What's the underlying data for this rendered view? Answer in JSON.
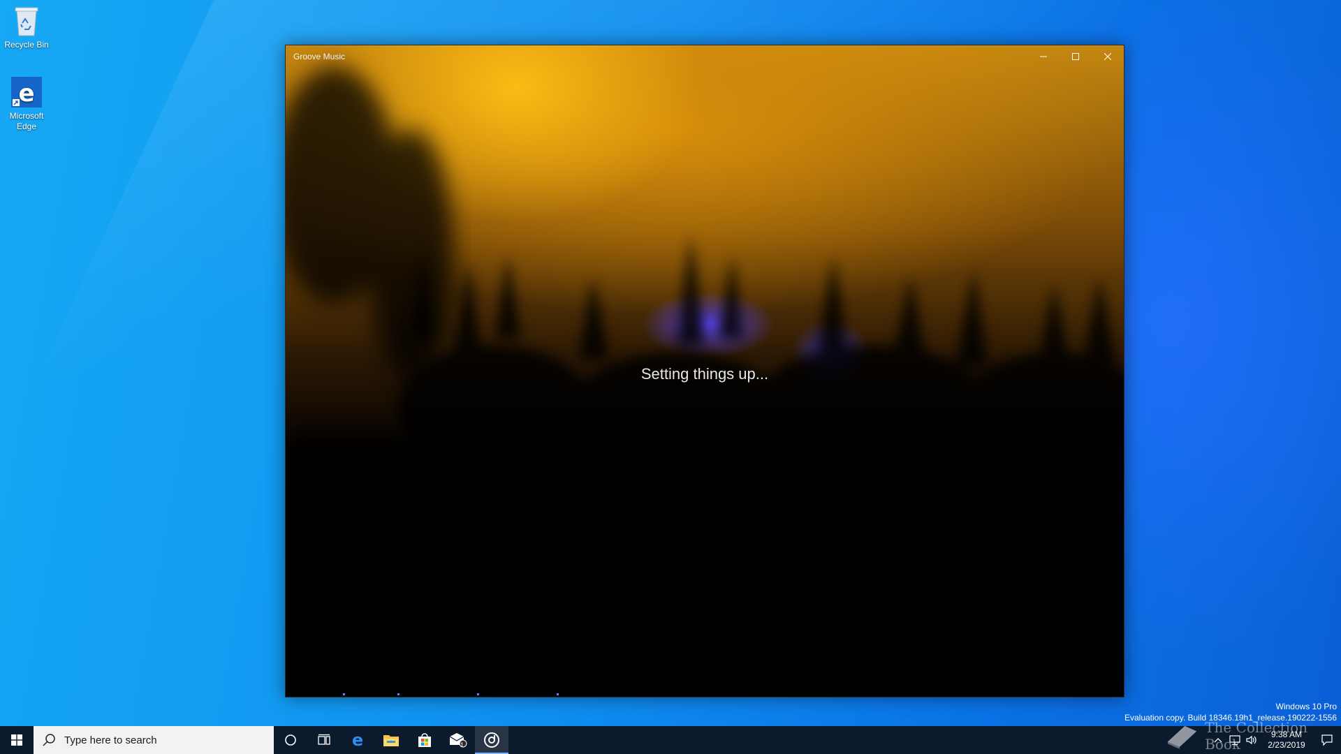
{
  "desktop": {
    "icons": [
      {
        "label": "Recycle Bin",
        "icon": "recycle-bin-icon"
      },
      {
        "label": "Microsoft Edge",
        "icon": "edge-icon"
      }
    ]
  },
  "window": {
    "title": "Groove Music",
    "status_text": "Setting things up...",
    "controls": {
      "minimize": "minimize-icon",
      "maximize": "maximize-icon",
      "close": "close-icon"
    }
  },
  "watermark": {
    "line1": "Windows 10 Pro",
    "line2": "Evaluation copy. Build 18346.19h1_release.190222-1556"
  },
  "taskbar": {
    "search_placeholder": "Type here to search",
    "apps": [
      "start-icon",
      "cortana-icon",
      "task-view-icon",
      "edge-icon",
      "file-explorer-icon",
      "store-icon",
      "mail-icon",
      "groove-music-icon"
    ],
    "mail_badge": "1"
  },
  "tray": {
    "time": "9:38 AM",
    "date": "2/23/2019"
  },
  "overlay": {
    "text": "The Collection Book"
  },
  "colors": {
    "desktop_blue": "#0f8ff0",
    "taskbar": "#0c1a2e",
    "window_glow": "#c58710"
  }
}
